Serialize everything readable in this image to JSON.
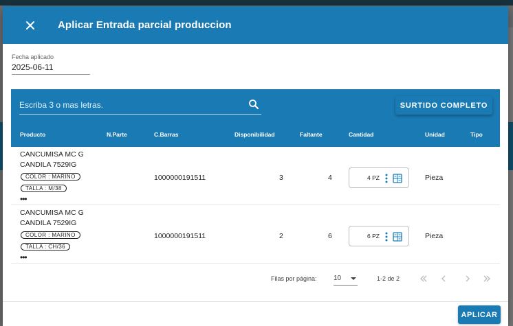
{
  "dialog": {
    "title": "Aplicar Entrada parcial produccion",
    "fecha_label": "Fecha aplicado",
    "fecha_value": "2025-06-11",
    "search_placeholder": "Escriba 3 o mas letras.",
    "surtido_label": "SURTIDO COMPLETO",
    "apply_label": "APLICAR"
  },
  "table": {
    "headers": [
      "Producto",
      "N.Parte",
      "C.Barras",
      "Disponibilidad",
      "Faltante",
      "Cantidad",
      "Unidad",
      "Tipo"
    ],
    "rows": [
      {
        "product_line1": "CANCUMISA MC G",
        "product_line2": "CANDILA 7529IG",
        "chip_color": "COLOR : MARINO",
        "chip_talla": "TALLA : M/38",
        "more": "•••",
        "barcode": "1000000191511",
        "disponibilidad": "3",
        "faltante": "4",
        "cantidad": "4 PZ",
        "unidad": "Pieza"
      },
      {
        "product_line1": "CANCUMISA MC G",
        "product_line2": "CANDILA 7529IG",
        "chip_color": "COLOR : MARINO",
        "chip_talla": "TALLA : CH/36",
        "more": "•••",
        "barcode": "1000000191511",
        "disponibilidad": "2",
        "faltante": "6",
        "cantidad": "6 PZ",
        "unidad": "Pieza"
      }
    ]
  },
  "pagination": {
    "rows_label": "Filas por página:",
    "rows_value": "10",
    "range": "1-2 de 2"
  },
  "colors": {
    "primary": "#1a7bb4",
    "text": "#212121"
  },
  "icons": {
    "close": "close-icon",
    "search": "search-icon",
    "menu": "more-vert-icon",
    "calc": "calculator-icon",
    "first": "first-page-icon",
    "prev": "chevron-left-icon",
    "next": "chevron-right-icon",
    "last": "last-page-icon"
  }
}
